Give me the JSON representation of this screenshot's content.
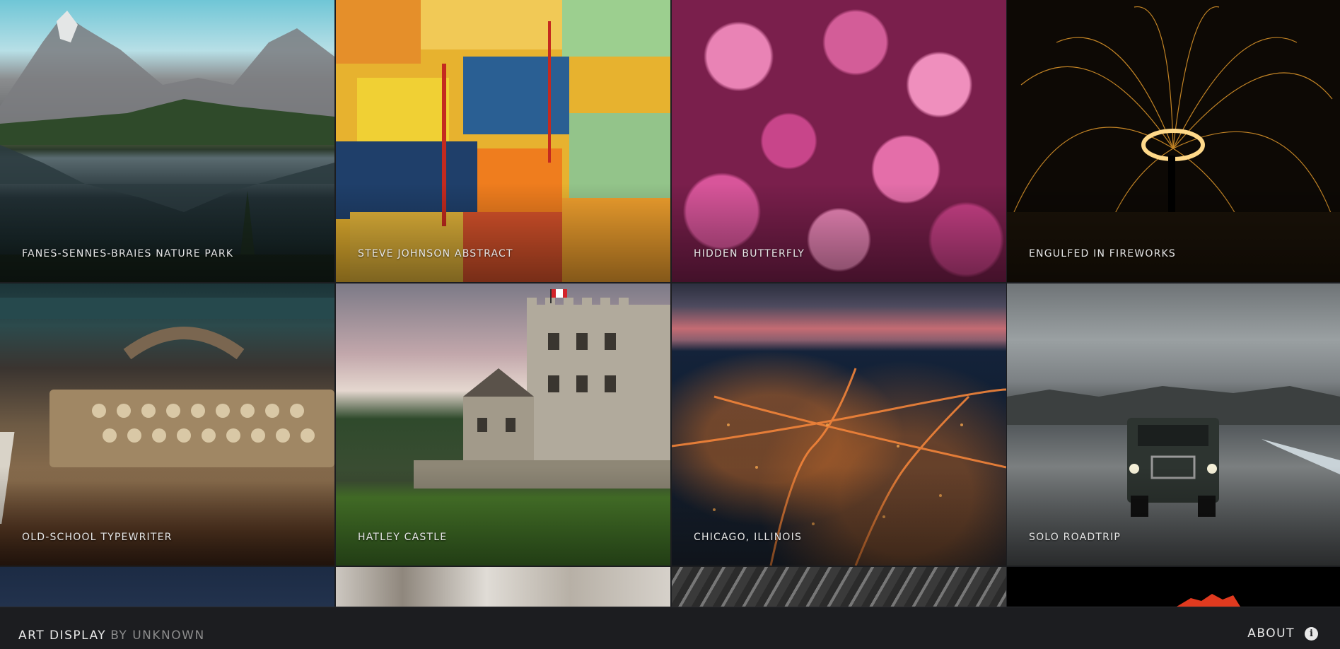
{
  "gallery": {
    "items": [
      {
        "title": "FANES-SENNES-BRAIES NATURE PARK"
      },
      {
        "title": "STEVE JOHNSON ABSTRACT"
      },
      {
        "title": "HIDDEN BUTTERFLY"
      },
      {
        "title": "ENGULFED IN FIREWORKS"
      },
      {
        "title": "OLD-SCHOOL TYPEWRITER"
      },
      {
        "title": "HATLEY CASTLE"
      },
      {
        "title": "CHICAGO, ILLINOIS"
      },
      {
        "title": "SOLO ROADTRIP"
      }
    ]
  },
  "footer": {
    "brand": "ART DISPLAY",
    "byline": "BY UNKNOWN",
    "about_label": "ABOUT",
    "info_icon": "i"
  }
}
